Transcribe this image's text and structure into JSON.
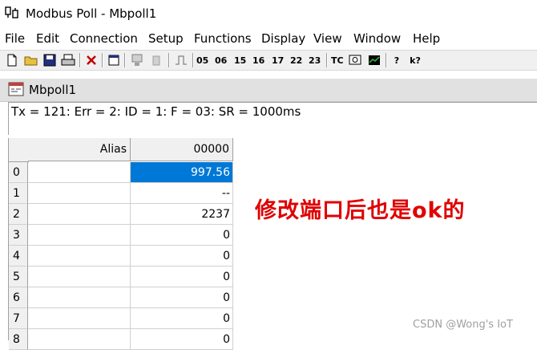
{
  "window": {
    "title": "Modbus Poll - Mbpoll1"
  },
  "menu": [
    "File",
    "Edit",
    "Connection",
    "Setup",
    "Functions",
    "Display",
    "View",
    "Window",
    "Help"
  ],
  "toolbar": {
    "func_buttons": [
      "05",
      "06",
      "15",
      "16",
      "17",
      "22",
      "23"
    ],
    "tc_label": "TC",
    "help_label": "?",
    "whatsthis_label": "k?"
  },
  "child": {
    "title": "Mbpoll1",
    "status": "Tx = 121: Err = 2: ID = 1: F = 03: SR = 1000ms"
  },
  "grid": {
    "columns": [
      "Alias",
      "00000"
    ],
    "rows": [
      {
        "index": "0",
        "alias": "",
        "value": "997.56",
        "selected": true
      },
      {
        "index": "1",
        "alias": "",
        "value": "--"
      },
      {
        "index": "2",
        "alias": "",
        "value": "2237"
      },
      {
        "index": "3",
        "alias": "",
        "value": "0"
      },
      {
        "index": "4",
        "alias": "",
        "value": "0"
      },
      {
        "index": "5",
        "alias": "",
        "value": "0"
      },
      {
        "index": "6",
        "alias": "",
        "value": "0"
      },
      {
        "index": "7",
        "alias": "",
        "value": "0"
      },
      {
        "index": "8",
        "alias": "",
        "value": "0"
      }
    ]
  },
  "annotation": "修改端口后也是ok的",
  "watermark": "CSDN @Wong's IoT",
  "colors": {
    "selection": "#0078d7",
    "annotation": "#e00000"
  }
}
